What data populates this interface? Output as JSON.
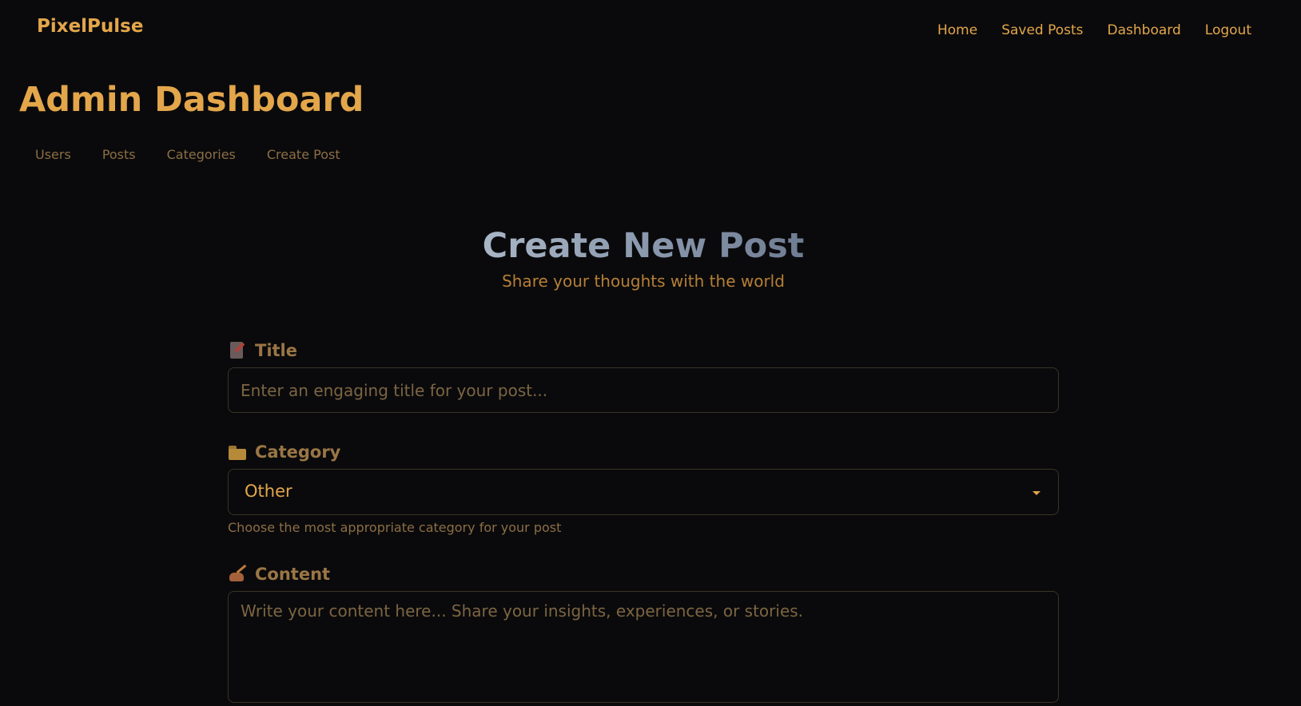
{
  "navbar": {
    "brand": "PixelPulse",
    "links": [
      "Home",
      "Saved Posts",
      "Dashboard",
      "Logout"
    ]
  },
  "page": {
    "title": "Admin Dashboard",
    "tabs": [
      "Users",
      "Posts",
      "Categories",
      "Create Post"
    ]
  },
  "form": {
    "title": "Create New Post",
    "subtitle": "Share your thoughts with the world",
    "title_field": {
      "icon": "memo-icon",
      "label": "Title",
      "placeholder": "Enter an engaging title for your post..."
    },
    "category_field": {
      "icon": "folder-icon",
      "label": "Category",
      "selected": "Other",
      "help": "Choose the most appropriate category for your post"
    },
    "content_field": {
      "icon": "writing-hand-icon",
      "label": "Content",
      "placeholder": "Write your content here... Share your insights, experiences, or stories."
    }
  },
  "colors": {
    "background": "#0a0a0c",
    "accent": "#e3a64a",
    "muted": "#8c6e44",
    "border": "#3a3426"
  }
}
